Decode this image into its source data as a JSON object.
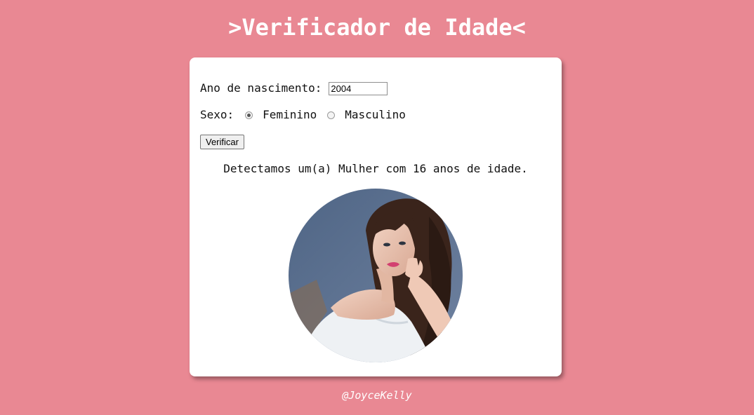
{
  "app": {
    "title": ">Verificador de Idade<"
  },
  "form": {
    "year_label": "Ano de nascimento:",
    "year_value": "2004",
    "sex_label": "Sexo:",
    "sex_options": [
      {
        "label": "Feminino",
        "checked": true
      },
      {
        "label": "Masculino",
        "checked": false
      }
    ],
    "verify_label": "Verificar"
  },
  "result": {
    "text": "Detectamos um(a) Mulher com 16 anos de idade.",
    "image_icon": "woman-photo"
  },
  "footer": {
    "credit": "@JoyceKelly"
  },
  "colors": {
    "background": "#e98893",
    "card": "#ffffff",
    "title_text": "#ffffff"
  }
}
